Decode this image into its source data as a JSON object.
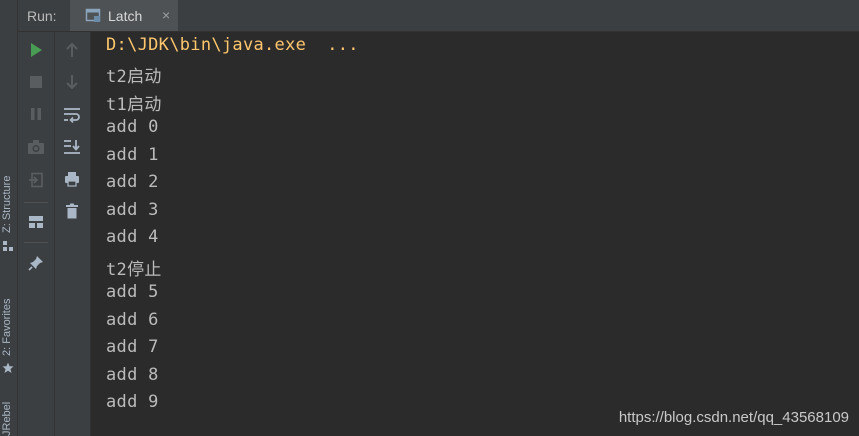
{
  "side_tabs": [
    {
      "label": "Z: Structure"
    },
    {
      "label": "2: Favorites"
    },
    {
      "label": "JRebel"
    }
  ],
  "header": {
    "run_label": "Run:",
    "tab_label": "Latch",
    "tab_close": "×"
  },
  "console": {
    "lines": [
      "D:\\JDK\\bin\\java.exe  ...",
      "t2启动",
      "t1启动",
      "add 0",
      "add 1",
      "add 2",
      "add 3",
      "add 4",
      "t2停止",
      "add 5",
      "add 6",
      "add 7",
      "add 8",
      "add 9"
    ]
  },
  "watermark": "https://blog.csdn.net/qq_43568109",
  "colors": {
    "background": "#2b2b2b",
    "panel": "#3c3f41",
    "run_green": "#499c54",
    "command_text": "#ffc66d",
    "output_text": "#bbbbbb"
  }
}
